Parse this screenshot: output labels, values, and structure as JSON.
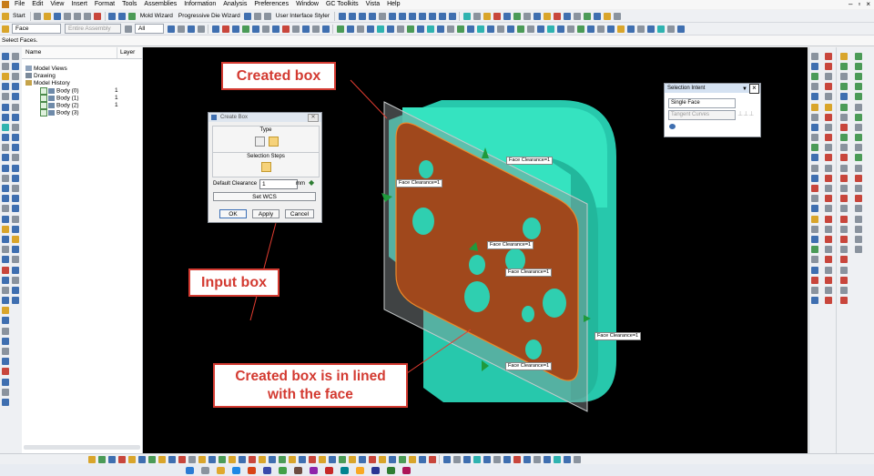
{
  "menubar": {
    "items": [
      "File",
      "Edit",
      "View",
      "Insert",
      "Format",
      "Tools",
      "Assemblies",
      "Information",
      "Analysis",
      "Preferences",
      "Window",
      "GC Toolkits",
      "Vista",
      "Help"
    ]
  },
  "toolbar1": {
    "start_label": "Start",
    "mold_wizard": "Mold Wizard",
    "progressive_die": "Progressive Die Wizard",
    "ui_styler": "User Interface Styler"
  },
  "toolbar2": {
    "select_filter": "Face",
    "assembly_scope": "Entire Assembly",
    "type_filter": "All"
  },
  "status_line": "Select Faces.",
  "navigator": {
    "col_name": "Name",
    "col_layer": "Layer",
    "rows": [
      {
        "label": "Model Views",
        "layer": ""
      },
      {
        "label": "Drawing",
        "layer": ""
      },
      {
        "label": "Model History",
        "layer": ""
      },
      {
        "label": "Body (0)",
        "layer": "1"
      },
      {
        "label": "Body (1)",
        "layer": "1"
      },
      {
        "label": "Body (2)",
        "layer": "1"
      },
      {
        "label": "Body (3)",
        "layer": "1"
      }
    ]
  },
  "create_box": {
    "title": "Create Box",
    "type_label": "Type",
    "selection_steps_label": "Selection Steps",
    "default_clearance_label": "Default Clearance",
    "clearance_value": "1",
    "unit": "mm",
    "set_wcs": "Set WCS",
    "ok": "OK",
    "apply": "Apply",
    "cancel": "Cancel"
  },
  "selection_intent": {
    "title": "Selection Intent",
    "face_rule": "Single Face",
    "curve_rule": "Tangent Curves"
  },
  "face_labels": [
    "Face Clearance=1",
    "Face Clearance=1",
    "Face Clearance=1",
    "Face Clearance=1",
    "Face Clearance=1",
    "Face Clearance=1"
  ],
  "callouts": {
    "created_box": "Created box",
    "input_box": "Input box",
    "inline_line1": "Created box is in lined",
    "inline_line2": "with the face"
  },
  "colors": {
    "callout_red": "#d33a31",
    "part_cyan": "#35e3c0",
    "face_brown": "#a0481c",
    "viewport_bg": "#000000"
  }
}
